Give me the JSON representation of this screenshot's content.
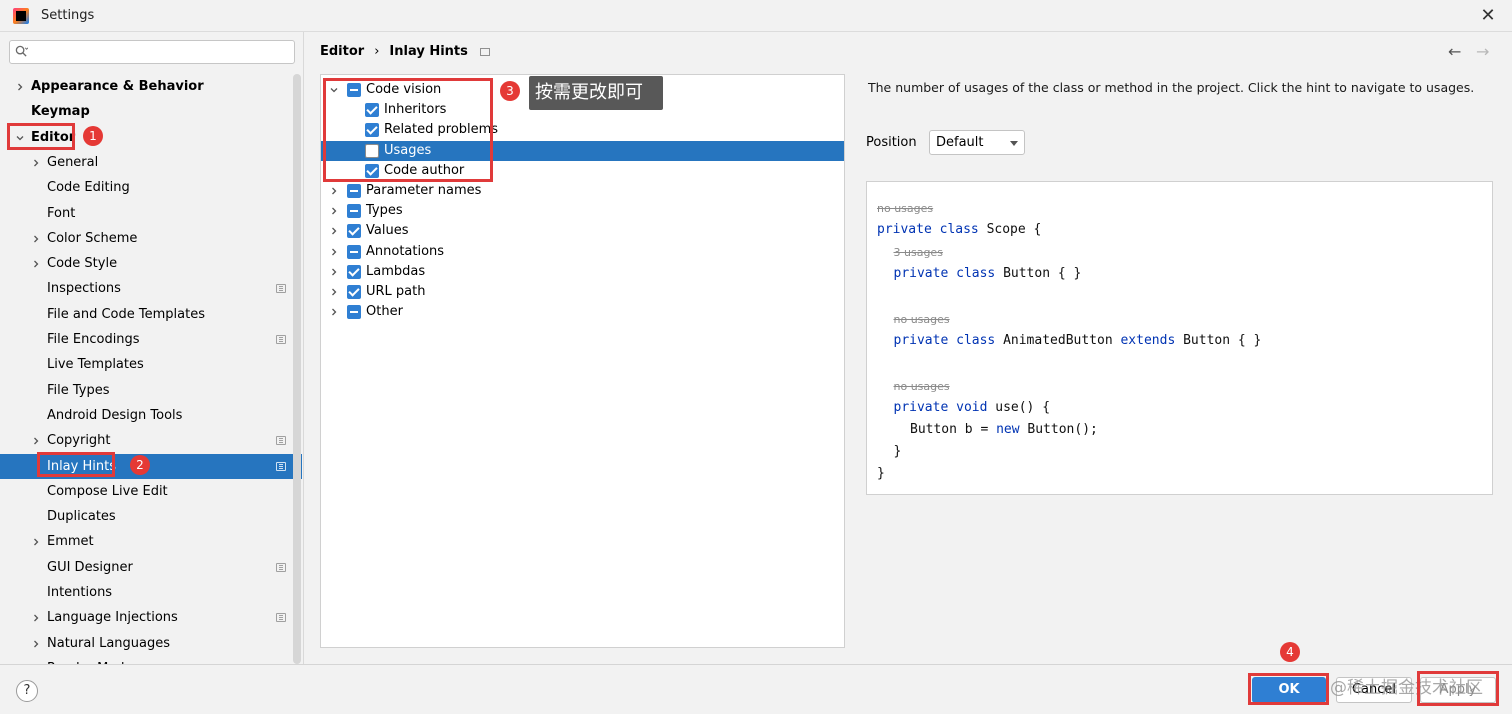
{
  "window": {
    "title": "Settings",
    "close_glyph": "✕"
  },
  "search": {
    "placeholder": ""
  },
  "sidebar": {
    "items": [
      {
        "label": "Appearance & Behavior",
        "bold": true,
        "chevron": "right",
        "indent": 0
      },
      {
        "label": "Keymap",
        "bold": true,
        "chevron": "none",
        "indent": 0
      },
      {
        "label": "Editor",
        "bold": true,
        "chevron": "down",
        "indent": 0
      },
      {
        "label": "General",
        "chevron": "right",
        "indent": 1
      },
      {
        "label": "Code Editing",
        "chevron": "none",
        "indent": 1
      },
      {
        "label": "Font",
        "chevron": "none",
        "indent": 1
      },
      {
        "label": "Color Scheme",
        "chevron": "right",
        "indent": 1
      },
      {
        "label": "Code Style",
        "chevron": "right",
        "indent": 1
      },
      {
        "label": "Inspections",
        "chevron": "none",
        "indent": 1,
        "gear": true
      },
      {
        "label": "File and Code Templates",
        "chevron": "none",
        "indent": 1
      },
      {
        "label": "File Encodings",
        "chevron": "none",
        "indent": 1,
        "gear": true
      },
      {
        "label": "Live Templates",
        "chevron": "none",
        "indent": 1
      },
      {
        "label": "File Types",
        "chevron": "none",
        "indent": 1
      },
      {
        "label": "Android Design Tools",
        "chevron": "none",
        "indent": 1
      },
      {
        "label": "Copyright",
        "chevron": "right",
        "indent": 1,
        "gear": true
      },
      {
        "label": "Inlay Hints",
        "chevron": "none",
        "indent": 1,
        "gear": true,
        "selected": true
      },
      {
        "label": "Compose Live Edit",
        "chevron": "none",
        "indent": 1
      },
      {
        "label": "Duplicates",
        "chevron": "none",
        "indent": 1
      },
      {
        "label": "Emmet",
        "chevron": "right",
        "indent": 1
      },
      {
        "label": "GUI Designer",
        "chevron": "none",
        "indent": 1,
        "gear": true
      },
      {
        "label": "Intentions",
        "chevron": "none",
        "indent": 1
      },
      {
        "label": "Language Injections",
        "chevron": "right",
        "indent": 1,
        "gear": true
      },
      {
        "label": "Natural Languages",
        "chevron": "right",
        "indent": 1
      },
      {
        "label": "Reader Mode",
        "chevron": "none",
        "indent": 1,
        "gear": true
      }
    ]
  },
  "breadcrumb": {
    "parent": "Editor",
    "separator": "›",
    "current": "Inlay Hints"
  },
  "nav": {
    "back": "←",
    "forward": "→"
  },
  "hints_tree": [
    {
      "label": "Code vision",
      "state": "partial",
      "chevron": "down",
      "level": 0
    },
    {
      "label": "Inheritors",
      "state": "checked",
      "chevron": "none",
      "level": 1
    },
    {
      "label": "Related problems",
      "state": "checked",
      "chevron": "none",
      "level": 1
    },
    {
      "label": "Usages",
      "state": "empty",
      "chevron": "none",
      "level": 1,
      "selected": true
    },
    {
      "label": "Code author",
      "state": "checked",
      "chevron": "none",
      "level": 1
    },
    {
      "label": "Parameter names",
      "state": "partial",
      "chevron": "right",
      "level": 0
    },
    {
      "label": "Types",
      "state": "partial",
      "chevron": "right",
      "level": 0
    },
    {
      "label": "Values",
      "state": "checked",
      "chevron": "right",
      "level": 0
    },
    {
      "label": "Annotations",
      "state": "partial",
      "chevron": "right",
      "level": 0
    },
    {
      "label": "Lambdas",
      "state": "checked",
      "chevron": "right",
      "level": 0
    },
    {
      "label": "URL path",
      "state": "checked",
      "chevron": "right",
      "level": 0
    },
    {
      "label": "Other",
      "state": "partial",
      "chevron": "right",
      "level": 0
    }
  ],
  "annotations": {
    "badges": [
      "1",
      "2",
      "3",
      "4"
    ],
    "tooltip": "按需更改即可",
    "watermark": "@稀土掘金技术社区"
  },
  "right_pane": {
    "description": "The number of usages of the class or method in the project. Click the hint to navigate to usages.",
    "position_label": "Position",
    "position_value": "Default"
  },
  "code_preview": [
    {
      "hint": "no usages"
    },
    {
      "parts": [
        [
          "kw",
          "private class "
        ],
        [
          "t",
          "Scope {"
        ]
      ]
    },
    {
      "hint": "3 usages",
      "indent": 1
    },
    {
      "parts": [
        [
          "kw",
          "private class "
        ],
        [
          "t",
          "Button { }"
        ]
      ],
      "indent": 1
    },
    {
      "hint": "no usages",
      "indent": 1
    },
    {
      "parts": [
        [
          "kw",
          "private class "
        ],
        [
          "t",
          "AnimatedButton "
        ],
        [
          "kw",
          "extends "
        ],
        [
          "t",
          "Button { }"
        ]
      ],
      "indent": 1
    },
    {
      "hint": "no usages",
      "indent": 1
    },
    {
      "parts": [
        [
          "kw",
          "private void "
        ],
        [
          "t",
          "use() {"
        ]
      ],
      "indent": 1
    },
    {
      "parts": [
        [
          "t",
          "Button b = "
        ],
        [
          "kw",
          "new "
        ],
        [
          "t",
          "Button();"
        ]
      ],
      "indent": 2
    },
    {
      "parts": [
        [
          "t",
          "}"
        ]
      ],
      "indent": 1
    },
    {
      "parts": [
        [
          "t",
          "}"
        ]
      ]
    }
  ],
  "footer": {
    "help": "?",
    "ok": "OK",
    "cancel": "Cancel",
    "apply": "Apply"
  },
  "colors": {
    "accent": "#2f7fd3",
    "selection": "#2675bf",
    "annotation_red": "#e03a3a",
    "keyword": "#0033b3"
  }
}
